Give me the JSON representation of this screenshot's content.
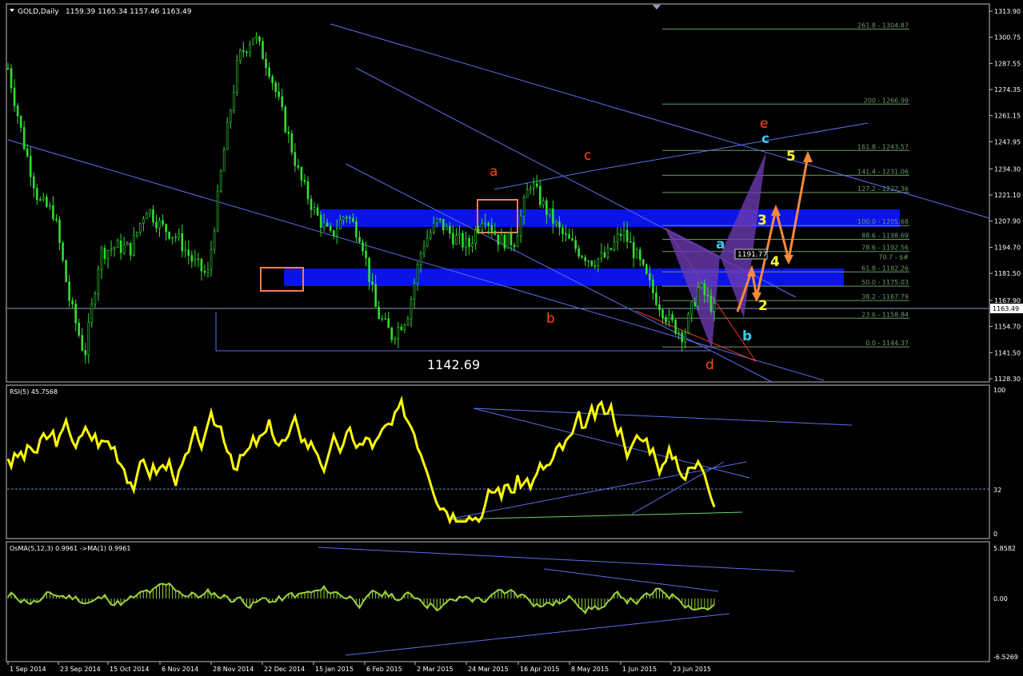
{
  "colors": {
    "background": "#000000",
    "frame": "#c0c0c0",
    "text": "#ffffff",
    "grid": "#808080",
    "candle": "#33dd33",
    "trendline": "#5b6ff0",
    "zone": "#0a14e6",
    "box": "#f08050",
    "fib": "#6a9a6a",
    "rsi": "#ffff00",
    "osma": "#9ad23c",
    "wave_red": "#ff4a10",
    "wave_cyan": "#33ccee",
    "wave_yellow": "#ffff33",
    "arrow": "#f58a3a",
    "purple": "#6a3ab0",
    "priceline": "#8aa0c0"
  },
  "header": {
    "symbol": "GOLD,Daily",
    "ohlc": "1159.39 1165.34 1157.46 1163.49"
  },
  "price_axis": {
    "labels": [
      "1313.90",
      "1300.75",
      "1287.55",
      "1274.35",
      "1261.15",
      "1247.95",
      "1234.30",
      "1221.10",
      "1207.90",
      "1194.70",
      "1181.50",
      "1167.90",
      "1154.70",
      "1141.50",
      "1128.30"
    ],
    "current": "1163.49",
    "marker": "1191.77"
  },
  "date_axis": [
    "1 Sep 2014",
    "23 Sep 2014",
    "15 Oct 2014",
    "6 Nov 2014",
    "28 Nov 2014",
    "22 Dec 2014",
    "15 Jan 2015",
    "6 Feb 2015",
    "2 Mar 2015",
    "24 Mar 2015",
    "16 Apr 2015",
    "8 May 2015",
    "1 Jun 2015",
    "23 Jun 2015"
  ],
  "fib_levels": [
    "261.8 - 1304.87",
    "200 - 1266.99",
    "161.8 - 1243.57",
    "141.4 - 1231.06",
    "127.2 - 1222.36",
    "100.0 - 1205.68",
    "88.6 - 1198.69",
    "78.6 - 1192.56",
    "70.7 - $#",
    "61.8 - 1182.26",
    "50.0 - 1175.03",
    "38.2 - 1167.79",
    "23.6 - 1158.84",
    "0.0 - 1144.37"
  ],
  "annotations": {
    "low_label": "1142.69",
    "a_red": "a",
    "b_red": "b",
    "c_red": "c",
    "d_red": "d",
    "e_red": "e",
    "a_cyan": "a",
    "b_cyan": "b",
    "c_cyan": "c",
    "w2": "2",
    "w3": "3",
    "w4": "4",
    "w5": "5"
  },
  "rsi_panel": {
    "title": "RSI(5) 45.7568",
    "labels": [
      "100",
      "32",
      "0"
    ]
  },
  "osma_panel": {
    "title": "OsMA(5,12,3) 0.9961  ->MA(1) 0.9961",
    "labels": [
      "5.8582",
      "0.00",
      "-6.5269"
    ]
  },
  "chart_data": {
    "type": "candlestick",
    "symbol": "GOLD",
    "timeframe": "Daily",
    "last_price": 1163.49,
    "ylim": [
      1128.3,
      1313.9
    ],
    "x": [
      "1 Sep 2014",
      "23 Sep 2014",
      "15 Oct 2014",
      "6 Nov 2014",
      "28 Nov 2014",
      "22 Dec 2014",
      "15 Jan 2015",
      "6 Feb 2015",
      "2 Mar 2015",
      "24 Mar 2015",
      "16 Apr 2015",
      "8 May 2015",
      "1 Jun 2015",
      "23 Jun 2015"
    ],
    "series": [
      {
        "values": [
          1285,
          1248,
          1218,
          1212,
          1168,
          1140,
          1192,
          1195,
          1194,
          1215,
          1205,
          1200,
          1188,
          1180,
          1240,
          1290,
          1302,
          1285,
          1258,
          1230,
          1212,
          1200,
          1212,
          1200,
          1162,
          1150,
          1160,
          1196,
          1208,
          1200,
          1195,
          1212,
          1198,
          1198,
          1228,
          1214,
          1202,
          1194,
          1188,
          1190,
          1203,
          1189,
          1172,
          1158,
          1150,
          1175,
          1163
        ]
      }
    ],
    "rsi": {
      "period": 5,
      "value": 45.7568,
      "levels": [
        32
      ],
      "ylim": [
        0,
        100
      ]
    },
    "osma": {
      "params": "5,12,3",
      "value": 0.9961,
      "ylim": [
        -6.5269,
        5.8582
      ]
    },
    "fibonacci": [
      [
        261.8,
        1304.87
      ],
      [
        200,
        1266.99
      ],
      [
        161.8,
        1243.57
      ],
      [
        141.4,
        1231.06
      ],
      [
        127.2,
        1222.36
      ],
      [
        100.0,
        1205.68
      ],
      [
        88.6,
        1198.69
      ],
      [
        78.6,
        1192.56
      ],
      [
        61.8,
        1182.26
      ],
      [
        50.0,
        1175.03
      ],
      [
        38.2,
        1167.79
      ],
      [
        23.6,
        1158.84
      ],
      [
        0.0,
        1144.37
      ]
    ],
    "zones": [
      [
        1203,
        1213
      ],
      [
        1176,
        1186
      ]
    ],
    "annotated_low": 1142.69
  }
}
